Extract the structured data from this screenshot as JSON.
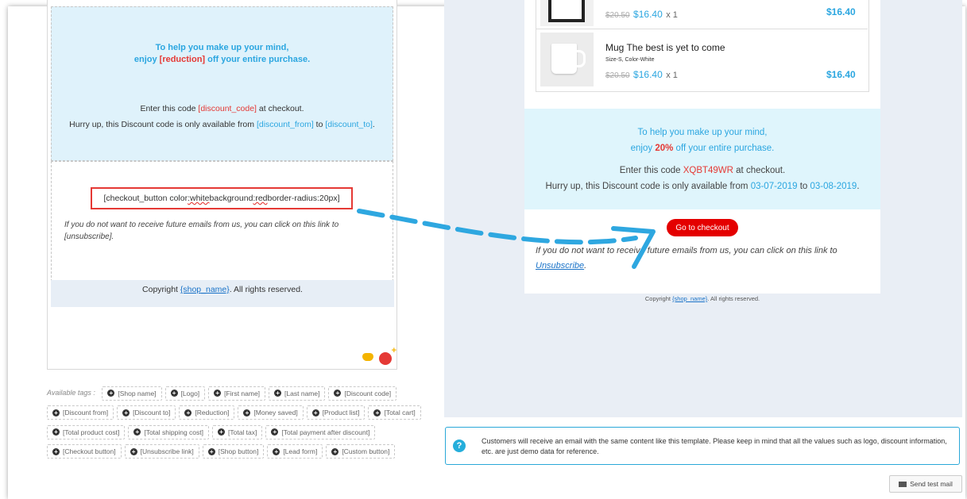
{
  "editor": {
    "promo_line1": "To help you make up your mind,",
    "promo_line2_a": "enjoy ",
    "promo_line2_tag": "[reduction]",
    "promo_line2_b": " off your entire purchase.",
    "code_a": "Enter this code ",
    "code_tag": "[discount_code]",
    "code_b": " at checkout.",
    "hurry_a": "Hurry up, this Discount code is only available from ",
    "hurry_from": "[discount_from]",
    "hurry_mid": " to ",
    "hurry_to": "[discount_to]",
    "hurry_end": ".",
    "btn_a": "[checkout_button color",
    "btn_sq1": ":white",
    "btn_b": " background",
    "btn_sq2": ":red",
    "btn_c": " border-radius:20px]",
    "unsub_text": "If you do not want to receive future emails from us, you can click on this link to [unsubscribe].",
    "copyright_a": "Copyright ",
    "copyright_link": "{shop_name}",
    "copyright_b": ". All rights reserved."
  },
  "tags": {
    "label": "Available tags :",
    "items": [
      "[Shop name]",
      "[Logo]",
      "[First name]",
      "[Last name]",
      "[Discount code]",
      "[Discount from]",
      "[Discount to]",
      "[Reduction]",
      "[Money saved]",
      "[Product list]",
      "[Total cart]",
      "[Total product cost]",
      "[Total shipping cost]",
      "[Total tax]",
      "[Total payment after discount]",
      "[Checkout button]",
      "[Unsubscribe link]",
      "[Shop button]",
      "[Lead form]",
      "[Custom button]"
    ]
  },
  "preview": {
    "products": [
      {
        "name": "",
        "attr": "",
        "old_price": "$20.50",
        "price": "$16.40",
        "qty": "x 1",
        "total": "$16.40"
      },
      {
        "name": "Mug The best is yet to come",
        "attr": "Size-S, Color-White",
        "old_price": "$20.50",
        "price": "$16.40",
        "qty": "x 1",
        "total": "$16.40"
      }
    ],
    "promo_line1": "To help you make up your mind,",
    "promo_line2_a": "enjoy ",
    "promo_reduction": "20%",
    "promo_line2_b": " off your entire purchase.",
    "code_a": "Enter this code ",
    "code_value": "XQBT49WR",
    "code_b": " at checkout.",
    "hurry_a": "Hurry up, this Discount code is only available from ",
    "date_from": "03-07-2019",
    "hurry_mid": " to ",
    "date_to": "03-08-2019",
    "hurry_end": ".",
    "checkout_button": "Go to checkout",
    "unsub_text": "If you do not want to receive future emails from us, you can click on this link to",
    "unsub_link": "Unsubscribe",
    "unsub_end": ".",
    "copyright_a": "Copyright ",
    "copyright_link": "{shop_name}",
    "copyright_b": ". All rights reserved."
  },
  "info": {
    "text": "Customers will receive an email with the same content like this template. Please keep in mind that all the values such as logo, discount information, etc. are just demo data for reference."
  },
  "send_button": "Send test mail",
  "colors": {
    "accent_blue": "#2ba6e0",
    "accent_red": "#e53935",
    "checkout_red": "#e40000",
    "arrow": "#2ea7e0"
  }
}
